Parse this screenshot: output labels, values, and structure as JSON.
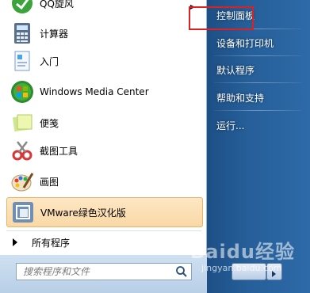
{
  "start_menu": {
    "programs": [
      {
        "label": "QQ旋风",
        "icon": "qq-xuanfeng-icon",
        "has_submenu": true
      },
      {
        "label": "计算器",
        "icon": "calculator-icon"
      },
      {
        "label": "入门",
        "icon": "getting-started-icon"
      },
      {
        "label": "Windows Media Center",
        "icon": "windows-media-center-icon"
      },
      {
        "label": "便笺",
        "icon": "sticky-notes-icon"
      },
      {
        "label": "截图工具",
        "icon": "snipping-tool-icon"
      },
      {
        "label": "画图",
        "icon": "paint-icon"
      },
      {
        "label": "VMware绿色汉化版",
        "icon": "vmware-icon",
        "highlighted": true
      }
    ],
    "all_programs_label": "所有程序",
    "search": {
      "placeholder": "搜索程序和文件"
    },
    "right_items": [
      {
        "label": "控制面板"
      },
      {
        "label": "设备和打印机"
      },
      {
        "label": "默认程序"
      },
      {
        "label": "帮助和支持"
      },
      {
        "label": "运行..."
      }
    ],
    "highlight_color": "#e02020"
  },
  "watermark": {
    "logo": "Baidu经验",
    "sub": "jingyan.baidu.com"
  }
}
